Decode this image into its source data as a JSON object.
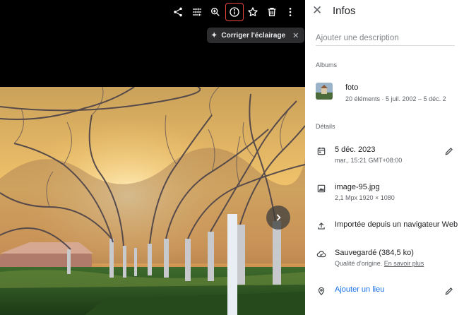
{
  "toolbar": {
    "icons": [
      "share-icon",
      "edit-tune-icon",
      "zoom-icon",
      "info-icon",
      "star-icon",
      "trash-icon",
      "more-icon"
    ]
  },
  "chip": {
    "label": "Corriger l'éclairage",
    "close": "✕"
  },
  "panel": {
    "title": "Infos",
    "close": "✕",
    "description_placeholder": "Ajouter une description",
    "albums_heading": "Albums",
    "album": {
      "name": "foto",
      "meta": "20 éléments · 5 juil. 2002 – 5 déc. 2"
    },
    "details_heading": "Détails",
    "date": {
      "main": "5 déc. 2023",
      "sub": "mar., 15:21   GMT+08:00"
    },
    "file": {
      "main": "image-95.jpg",
      "sub": "2,1 Mpx    1920 × 1080"
    },
    "upload": {
      "main": "Importée depuis un navigateur Web"
    },
    "backup": {
      "main": "Sauvegardé (384,5 ko)",
      "sub": "Qualité d'origine.",
      "link": "En savoir plus"
    },
    "location": {
      "main": "Ajouter un lieu"
    }
  },
  "colors": {
    "active_outline": "#e8453c",
    "link_blue": "#1a73e8",
    "panel_bg": "#ffffff",
    "viewer_bg": "#000000"
  }
}
